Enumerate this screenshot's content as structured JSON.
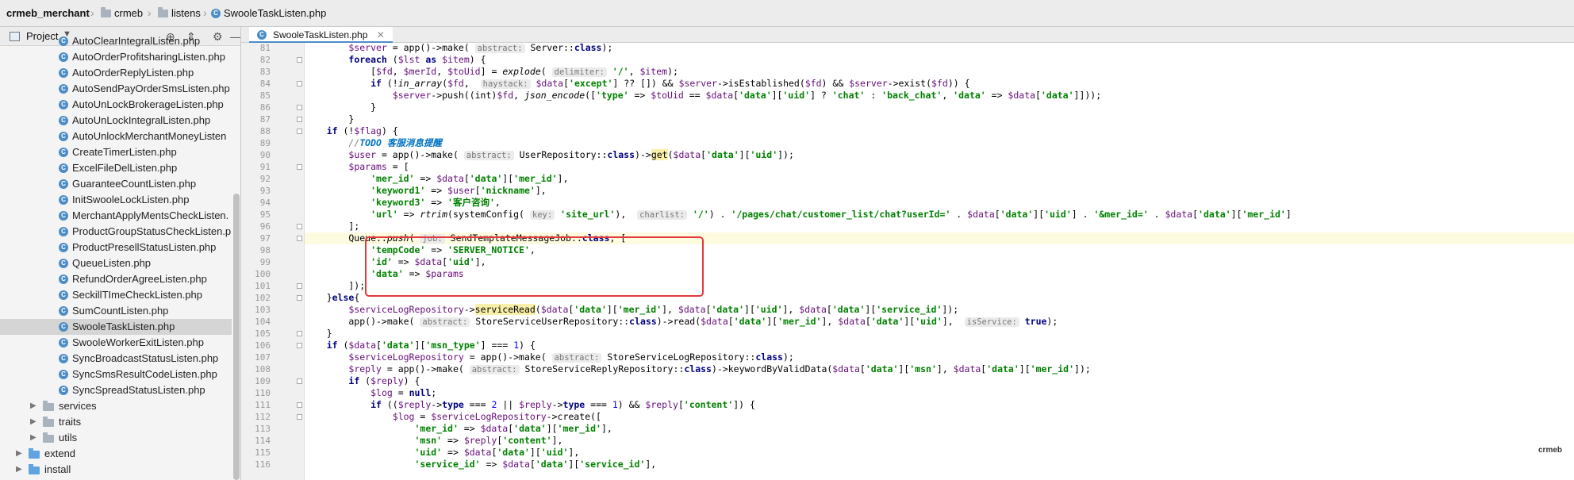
{
  "breadcrumb": [
    {
      "label": "crmeb_merchant",
      "type": "project"
    },
    {
      "label": "crmeb",
      "type": "folder"
    },
    {
      "label": "listens",
      "type": "folder"
    },
    {
      "label": "SwooleTaskListen.php",
      "type": "file"
    }
  ],
  "project_panel": {
    "title": "Project",
    "icons": [
      "locate-icon",
      "collapse-icon",
      "gear-icon",
      "minimize-icon"
    ],
    "files": [
      "AutoClearIntegralListen.php",
      "AutoOrderProfitsharingListen.php",
      "AutoOrderReplyListen.php",
      "AutoSendPayOrderSmsListen.php",
      "AutoUnLockBrokerageListen.php",
      "AutoUnLockIntegralListen.php",
      "AutoUnlockMerchantMoneyListen",
      "CreateTimerListen.php",
      "ExcelFileDelListen.php",
      "GuaranteeCountListen.php",
      "InitSwooleLockListen.php",
      "MerchantApplyMentsCheckListen.",
      "ProductGroupStatusCheckListen.p",
      "ProductPresellStatusListen.php",
      "QueueListen.php",
      "RefundOrderAgreeListen.php",
      "SeckillTImeCheckListen.php",
      "SumCountListen.php",
      "SwooleTaskListen.php",
      "SwooleWorkerExitListen.php",
      "SyncBroadcastStatusListen.php",
      "SyncSmsResultCodeListen.php",
      "SyncSpreadStatusListen.php"
    ],
    "selected_file": "SwooleTaskListen.php",
    "folders": [
      {
        "label": "services",
        "indent": 1
      },
      {
        "label": "traits",
        "indent": 1
      },
      {
        "label": "utils",
        "indent": 1
      },
      {
        "label": "extend",
        "indent": 0
      },
      {
        "label": "install",
        "indent": 0
      }
    ]
  },
  "editor": {
    "tab_label": "SwooleTaskListen.php",
    "current_line": 97,
    "line_numbers": [
      81,
      82,
      83,
      84,
      85,
      86,
      87,
      88,
      89,
      90,
      91,
      92,
      93,
      94,
      95,
      96,
      97,
      98,
      99,
      100,
      101,
      102,
      103,
      104,
      105,
      106,
      107,
      108,
      109,
      110,
      111,
      112,
      113,
      114,
      115,
      116
    ],
    "code_html": [
      "        <span class=\"v\">$server</span> = app()-&gt;make( <span class=\"h\">abstract:</span> Server::<span class=\"k\">class</span>);",
      "        <span class=\"k\">foreach</span> (<span class=\"v\">$lst</span> <span class=\"k\">as</span> <span class=\"v\">$item</span>) {",
      "            [<span class=\"v\">$fd</span>, <span class=\"v\">$merId</span>, <span class=\"v\">$toUid</span>] = <span class=\"f\">explode</span>( <span class=\"h\">delimiter:</span> <span class=\"s\">'/'</span>, <span class=\"v\">$item</span>);",
      "            <span class=\"k\">if</span> (!<span class=\"f\">in_array</span>(<span class=\"v\">$fd</span>,  <span class=\"h\">haystack:</span> <span class=\"v\">$data</span>[<span class=\"s\">'except'</span>] ?? []) &amp;&amp; <span class=\"v\">$server</span>-&gt;isEstablished(<span class=\"v\">$fd</span>) &amp;&amp; <span class=\"v\">$server</span>-&gt;exist(<span class=\"v\">$fd</span>)) {",
      "                <span class=\"v\">$server</span>-&gt;push((int)<span class=\"v\">$fd</span>, <span class=\"f\">json_encode</span>([<span class=\"s\">'type'</span> =&gt; <span class=\"v\">$toUid</span> == <span class=\"v\">$data</span>[<span class=\"s\">'data'</span>][<span class=\"s\">'uid'</span>] ? <span class=\"s\">'chat'</span> : <span class=\"s\">'back_chat'</span>, <span class=\"s\">'data'</span> =&gt; <span class=\"v\">$data</span>[<span class=\"s\">'data'</span>]]));",
      "            }",
      "        }",
      "    <span class=\"k\">if</span> (!<span class=\"v\">$flag</span>) {",
      "        <span class=\"c\">//</span><span class=\"td\">TODO 客服消息提醒</span>",
      "        <span class=\"v\">$user</span> = app()-&gt;make( <span class=\"h\">abstract:</span> UserRepository::<span class=\"k\">class</span>)-&gt;<span class=\"y\">get</span>(<span class=\"v\">$data</span>[<span class=\"s\">'data'</span>][<span class=\"s\">'uid'</span>]);",
      "        <span class=\"v\">$params</span> = [",
      "            <span class=\"s\">'mer_id'</span> =&gt; <span class=\"v\">$data</span>[<span class=\"s\">'data'</span>][<span class=\"s\">'mer_id'</span>],",
      "            <span class=\"s\">'keyword1'</span> =&gt; <span class=\"v\">$user</span>[<span class=\"s\">'nickname'</span>],",
      "            <span class=\"s\">'keyword3'</span> =&gt; <span class=\"s\">'客户咨询'</span>,",
      "            <span class=\"s\">'url'</span> =&gt; <span class=\"f\">rtrim</span>(systemConfig( <span class=\"h\">key:</span> <span class=\"s\">'site_url'</span>),  <span class=\"h\">charlist:</span> <span class=\"s\">'/'</span>) . <span class=\"s\">'/pages/chat/customer_list/chat?userId='</span> . <span class=\"v\">$data</span>[<span class=\"s\">'data'</span>][<span class=\"s\">'uid'</span>] . <span class=\"s\">'&amp;mer_id='</span> . <span class=\"v\">$data</span>[<span class=\"s\">'data'</span>][<span class=\"s\">'mer_id'</span>]",
      "        ];",
      "        Queue::<span class=\"f\">push</span>( <span class=\"h\">job:</span> SendTemplateMessageJob::<span class=\"k\">class</span>, [",
      "            <span class=\"s\">'tempCode'</span> =&gt; <span class=\"s\">'SERVER_NOTICE'</span>,",
      "            <span class=\"s\">'id'</span> =&gt; <span class=\"v\">$data</span>[<span class=\"s\">'uid'</span>],",
      "            <span class=\"s\">'data'</span> =&gt; <span class=\"v\">$params</span>",
      "        ]);",
      "    }<span class=\"k\">else</span>{",
      "        <span class=\"v\">$serviceLogRepository</span>-&gt;<span class=\"y\">serviceRead</span>(<span class=\"v\">$data</span>[<span class=\"s\">'data'</span>][<span class=\"s\">'mer_id'</span>], <span class=\"v\">$data</span>[<span class=\"s\">'data'</span>][<span class=\"s\">'uid'</span>], <span class=\"v\">$data</span>[<span class=\"s\">'data'</span>][<span class=\"s\">'service_id'</span>]);",
      "        app()-&gt;make( <span class=\"h\">abstract:</span> StoreServiceUserRepository::<span class=\"k\">class</span>)-&gt;read(<span class=\"v\">$data</span>[<span class=\"s\">'data'</span>][<span class=\"s\">'mer_id'</span>], <span class=\"v\">$data</span>[<span class=\"s\">'data'</span>][<span class=\"s\">'uid'</span>],  <span class=\"h\">isService:</span> <span class=\"k\">true</span>);",
      "    }",
      "    <span class=\"k\">if</span> (<span class=\"v\">$data</span>[<span class=\"s\">'data'</span>][<span class=\"s\">'msn_type'</span>] === <span class=\"n\">1</span>) {",
      "        <span class=\"v\">$serviceLogRepository</span> = app()-&gt;make( <span class=\"h\">abstract:</span> StoreServiceLogRepository::<span class=\"k\">class</span>);",
      "        <span class=\"v\">$reply</span> = app()-&gt;make( <span class=\"h\">abstract:</span> StoreServiceReplyRepository::<span class=\"k\">class</span>)-&gt;keywordByValidData(<span class=\"v\">$data</span>[<span class=\"s\">'data'</span>][<span class=\"s\">'msn'</span>], <span class=\"v\">$data</span>[<span class=\"s\">'data'</span>][<span class=\"s\">'mer_id'</span>]);",
      "        <span class=\"k\">if</span> (<span class=\"v\">$reply</span>) {",
      "            <span class=\"v\">$log</span> = <span class=\"k\">null</span>;",
      "            <span class=\"k\">if</span> ((<span class=\"v\">$reply</span>-&gt;<span class=\"k\">type</span> === <span class=\"n\">2</span> || <span class=\"v\">$reply</span>-&gt;<span class=\"k\">type</span> === <span class=\"n\">1</span>) &amp;&amp; <span class=\"v\">$reply</span>[<span class=\"s\">'content'</span>]) {",
      "                <span class=\"v\">$log</span> = <span class=\"v\">$serviceLogRepository</span>-&gt;create([",
      "                    <span class=\"s\">'mer_id'</span> =&gt; <span class=\"v\">$data</span>[<span class=\"s\">'data'</span>][<span class=\"s\">'mer_id'</span>],",
      "                    <span class=\"s\">'msn'</span> =&gt; <span class=\"v\">$reply</span>[<span class=\"s\">'content'</span>],",
      "                    <span class=\"s\">'uid'</span> =&gt; <span class=\"v\">$data</span>[<span class=\"s\">'data'</span>][<span class=\"s\">'uid'</span>],",
      "                    <span class=\"s\">'service_id'</span> =&gt; <span class=\"v\">$data</span>[<span class=\"s\">'data'</span>][<span class=\"s\">'service_id'</span>],"
    ]
  },
  "watermark": "crmeb",
  "colors": {
    "highlight_box": "#e4393c",
    "keyword": "#000080",
    "string": "#008000",
    "variable": "#660e7a",
    "selected_row": "#d5d5d5"
  }
}
